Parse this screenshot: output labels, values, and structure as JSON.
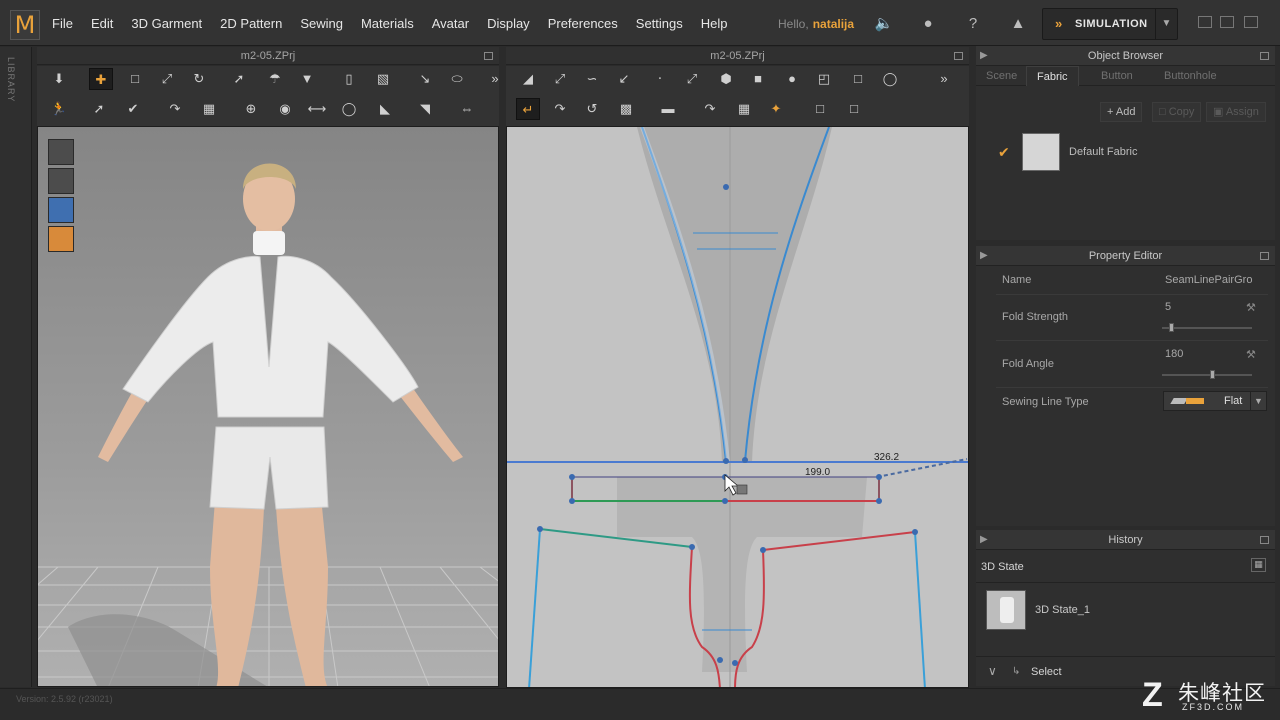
{
  "app": {
    "logo": "M",
    "menus": [
      "File",
      "Edit",
      "3D Garment",
      "2D Pattern",
      "Sewing",
      "Materials",
      "Avatar",
      "Display",
      "Preferences",
      "Settings",
      "Help"
    ],
    "hello_label": "Hello,",
    "user": "natalija",
    "simulation_label": "SIMULATION",
    "library_label": "LIBRARY",
    "version": "Version: 2.5.92     (r23021)"
  },
  "viewport3d": {
    "title": "m2-05.ZPrj"
  },
  "viewport2d": {
    "title": "m2-05.ZPrj",
    "measure_a": "326.2",
    "measure_b": "199.0"
  },
  "object_browser": {
    "title": "Object Browser",
    "tabs": [
      "Scene",
      "Fabric",
      "Button",
      "Buttonhole"
    ],
    "active_tab": "Fabric",
    "buttons": {
      "add": "Add",
      "copy": "Copy",
      "assign": "Assign"
    },
    "fabric_name": "Default Fabric"
  },
  "property_editor": {
    "title": "Property Editor",
    "name_label": "Name",
    "name_value": "SeamLinePairGro",
    "fold_strength_label": "Fold Strength",
    "fold_strength_value": "5",
    "fold_strength_level": 0.1,
    "fold_angle_label": "Fold Angle",
    "fold_angle_value": "180",
    "fold_angle_level": 0.55,
    "sewing_line_type_label": "Sewing Line Type",
    "sewing_line_type_value": "Flat"
  },
  "history": {
    "title": "History",
    "state_label": "3D State",
    "item_label": "3D State_1",
    "select_label": "Select"
  },
  "watermark": {
    "logo_letter": "Z",
    "cn": "朱峰社区",
    "en": "ZF3D.COM"
  },
  "colors": {
    "accent": "#e9a23b",
    "seam_blue": "#3aa0d8",
    "seam_red": "#c8404a",
    "seam_green": "#2e9a55"
  }
}
